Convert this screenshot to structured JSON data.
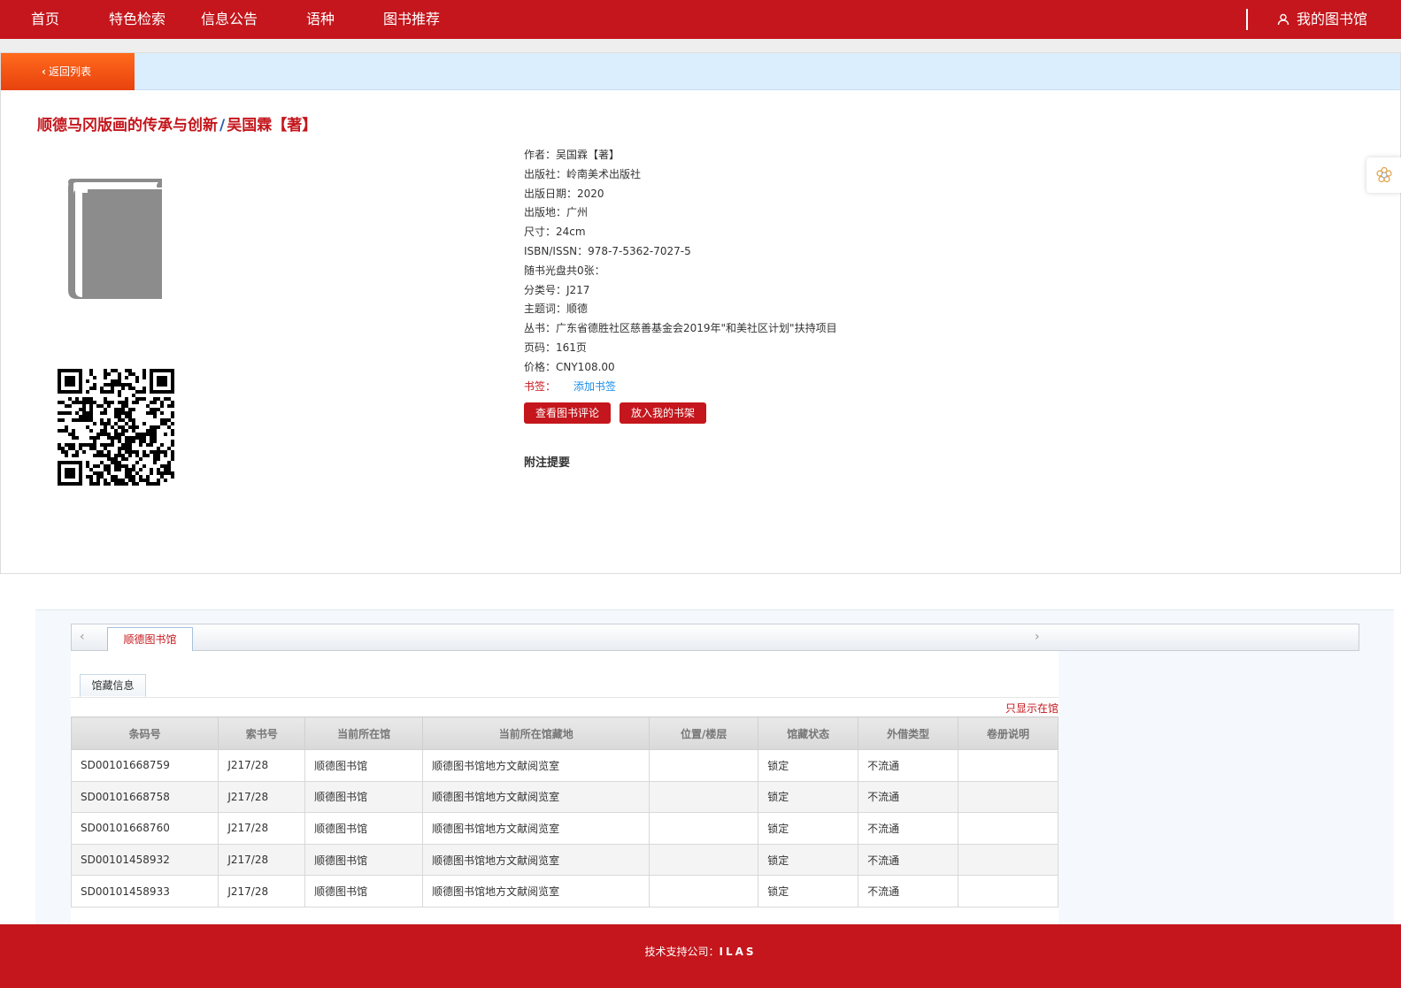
{
  "topnav": {
    "items": [
      "首页",
      "特色检索",
      "信息公告",
      "语种",
      "图书推荐"
    ],
    "mylib": "我的图书馆"
  },
  "back_label": "返回列表",
  "book": {
    "title_main": "顺德马冈版画的传承与创新",
    "title_sep": "/",
    "title_author": "吴国霖【著】",
    "fields": [
      "作者：吴国霖【著】",
      "出版社：岭南美术出版社",
      "出版日期：2020",
      "出版地：广州",
      "尺寸：24cm",
      "ISBN/ISSN：978-7-5362-7027-5",
      "随书光盘共0张：",
      "分类号：J217",
      "主题词：顺德",
      "丛书：广东省德胜社区慈善基金会2019年\"和美社区计划\"扶持项目",
      "页码：161页",
      "价格：CNY108.00"
    ],
    "bookmark_label": "书签：",
    "bookmark_link": "添加书签"
  },
  "buttons": {
    "reviews": "查看图书评论",
    "shelf": "放入我的书架"
  },
  "note_title": "附注提要",
  "holdings": {
    "library_tab": "顺德图书馆",
    "sub_tab": "馆藏信息",
    "only_in_lib": "只显示在馆",
    "columns": [
      "条码号",
      "索书号",
      "当前所在馆",
      "当前所在馆藏地",
      "位置/楼层",
      "馆藏状态",
      "外借类型",
      "卷册说明"
    ],
    "rows": [
      [
        "SD00101668759",
        "J217/28",
        "顺德图书馆",
        "顺德图书馆地方文献阅览室",
        "",
        "锁定",
        "不流通",
        ""
      ],
      [
        "SD00101668758",
        "J217/28",
        "顺德图书馆",
        "顺德图书馆地方文献阅览室",
        "",
        "锁定",
        "不流通",
        ""
      ],
      [
        "SD00101668760",
        "J217/28",
        "顺德图书馆",
        "顺德图书馆地方文献阅览室",
        "",
        "锁定",
        "不流通",
        ""
      ],
      [
        "SD00101458932",
        "J217/28",
        "顺德图书馆",
        "顺德图书馆地方文献阅览室",
        "",
        "锁定",
        "不流通",
        ""
      ],
      [
        "SD00101458933",
        "J217/28",
        "顺德图书馆",
        "顺德图书馆地方文献阅览室",
        "",
        "锁定",
        "不流通",
        ""
      ]
    ]
  },
  "footer": {
    "label": "技术支持公司：",
    "brand": "ILAS"
  },
  "colors": {
    "brand_red": "#c4161c",
    "back_orange": "#f15a16",
    "link_blue": "#1a8ee8"
  },
  "icons": [
    "user-icon",
    "chevron-left-icon",
    "book-cover-icon",
    "qr-code-icon",
    "settings-flower-icon",
    "chevron-right-icon"
  ]
}
